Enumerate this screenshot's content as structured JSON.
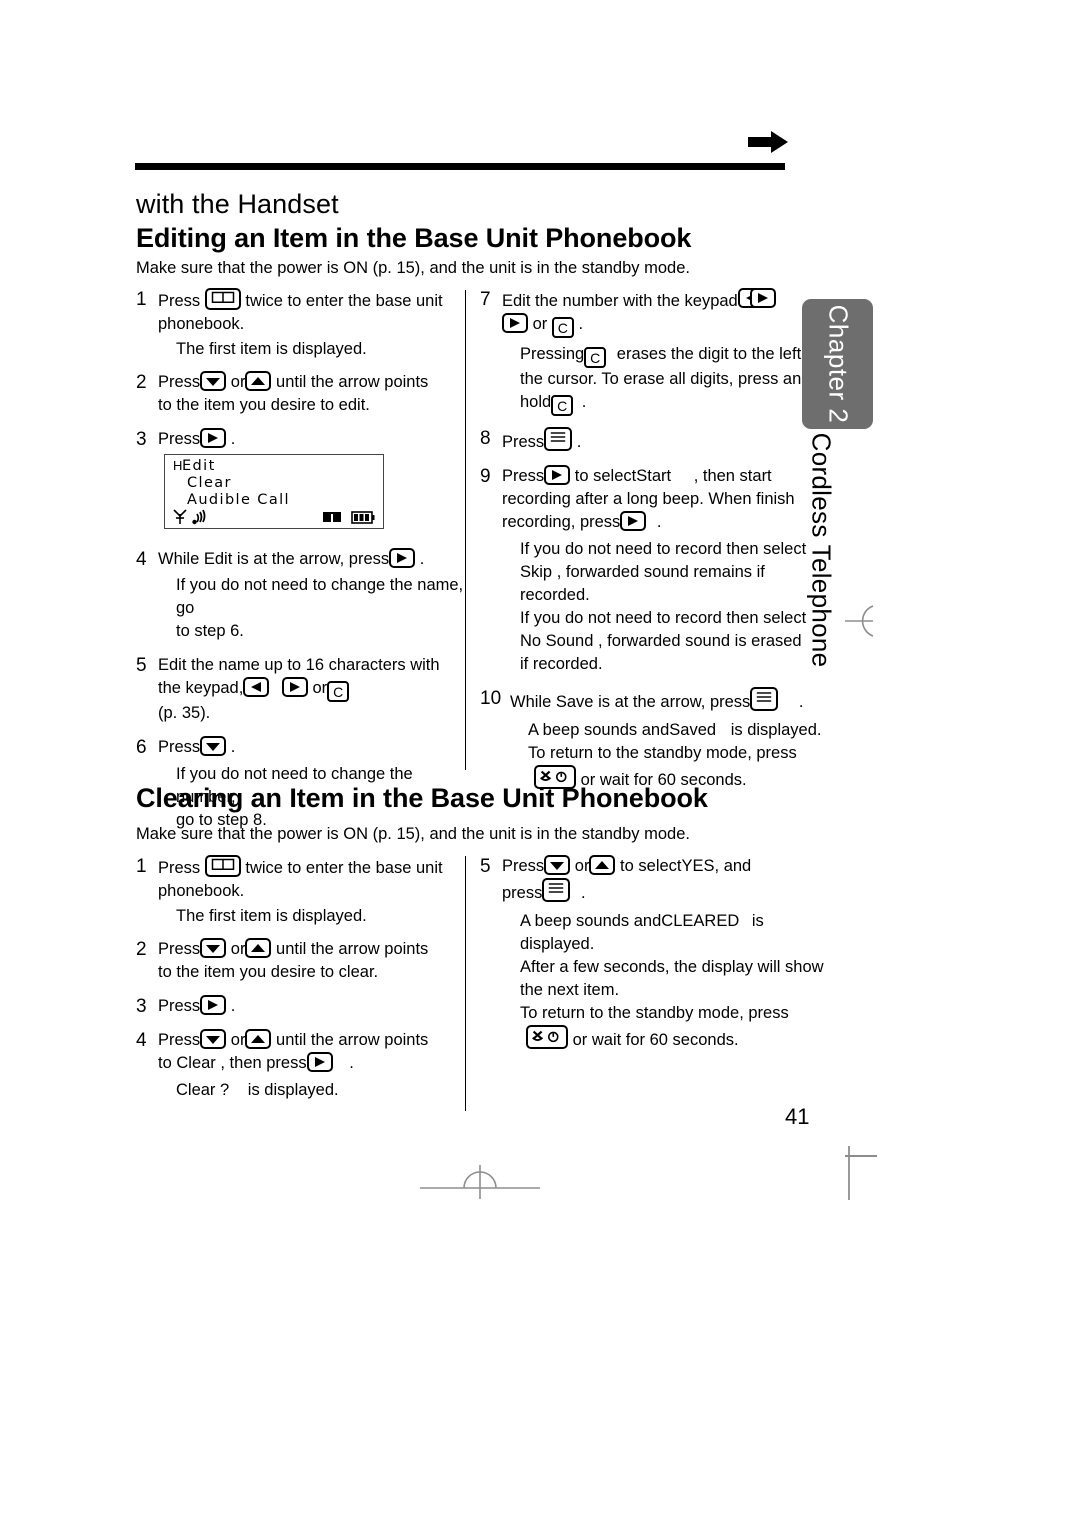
{
  "page": {
    "number": "41",
    "subheading": "with the Handset"
  },
  "chapter_tab": {
    "label": "Chapter 2",
    "name": "Cordless Telephone",
    "bg_color": "#6e6e6e",
    "text_color": "#ffffff"
  },
  "section_edit": {
    "title": "Editing an Item in the Base Unit Phonebook",
    "lead": "Make sure that the power is ON (p. 15), and the unit is in the standby mode.",
    "steps_left": [
      {
        "num": "1",
        "parts": [
          "Press ",
          "[book-key]",
          " twice to enter the base unit phonebook."
        ],
        "note": "The first item is displayed."
      },
      {
        "num": "2",
        "parts": [
          "Press ",
          "[down-key]",
          " or ",
          "[up-key]",
          " until the arrow points to the item you desire to edit."
        ]
      },
      {
        "num": "3",
        "parts": [
          "Press ",
          "[right-key]",
          " ."
        ]
      },
      {
        "num": "4",
        "parts": [
          "While ",
          "Edit",
          " is at the arrow, press ",
          "[right-key]",
          " ."
        ],
        "note": "If you do not need to change the name, go to step 6."
      },
      {
        "num": "5",
        "parts": [
          "Edit the name up to 16 characters with the keypad, ",
          "[left-key]",
          " , ",
          "[right-key]",
          " or ",
          "[C-key]",
          " (p. 35)."
        ]
      },
      {
        "num": "6",
        "parts": [
          "Press ",
          "[down-key]",
          " ."
        ],
        "note": "If you do not need to change the number, go to step 8."
      }
    ],
    "steps_right": [
      {
        "num": "7",
        "parts": [
          "Edit the number with the keypad, ",
          "[keypad-pair]",
          " , ",
          "[right-key]",
          " or ",
          "[C-key]",
          " ."
        ],
        "note": "Pressing [C-key] erases the digit to the left of the cursor. To erase all digits, press and hold [C-key] ."
      },
      {
        "num": "8",
        "parts": [
          "Press ",
          "[menu-key]",
          " ."
        ]
      },
      {
        "num": "9",
        "parts": [
          "Press ",
          "[right-key]",
          " to select ",
          "Start",
          " , then start recording after a long beep. When finish recording, press ",
          "[right-key]",
          " ."
        ],
        "notes": [
          "If you do not need to record then select Skip , forwarded sound remains if recorded.",
          "If you do not need to record then select No Sound , forwarded sound is erased if recorded."
        ]
      },
      {
        "num": "10",
        "parts": [
          "While ",
          "Save",
          " is at the arrow, press ",
          "[menu-key]",
          " ."
        ],
        "notes": [
          "A beep sounds and Saved is displayed.",
          "To return to the standby mode, press [off-key] or wait for 60 seconds."
        ]
      }
    ]
  },
  "section_clear": {
    "title": "Clearing an Item in the Base Unit Phonebook",
    "lead": "Make sure that the power is ON (p. 15), and the unit is in the standby mode.",
    "steps_left": [
      {
        "num": "1",
        "parts": [
          "Press ",
          "[book-key]",
          " twice to enter the base unit phonebook."
        ],
        "note": "The first item is displayed."
      },
      {
        "num": "2",
        "parts": [
          "Press ",
          "[down-key]",
          " or ",
          "[up-key]",
          " until the arrow points to the item you desire to clear."
        ]
      },
      {
        "num": "3",
        "parts": [
          "Press ",
          "[right-key]",
          " ."
        ]
      },
      {
        "num": "4",
        "parts": [
          "Press ",
          "[down-key]",
          " or ",
          "[up-key]",
          " until the arrow points to ",
          "Clear",
          " , then press ",
          "[right-key]",
          " ."
        ],
        "note": "Clear ? is displayed."
      }
    ],
    "steps_right": [
      {
        "num": "5",
        "parts": [
          "Press ",
          "[down-key]",
          " or ",
          "[up-key]",
          " to select ",
          "YES",
          " , and press ",
          "[menu-key]",
          " ."
        ],
        "notes": [
          "A beep sounds and CLEARED is displayed.",
          "After a few seconds, the display will show the next item.",
          "To return to the standby mode, press [off-key] or wait for 60 seconds."
        ]
      }
    ]
  },
  "lcd": {
    "cursor": "H",
    "line1": "Edit",
    "line2": "Clear",
    "line3": "Audible Call",
    "status_left": [
      "antenna-icon",
      "signal-icon"
    ],
    "status_right": [
      "book-icon",
      "battery-icon"
    ]
  },
  "text": {
    "press": "Press",
    "or": "or",
    "twice_to_enter": "twice to enter the base unit",
    "phonebook": "phonebook.",
    "first_item": "The first item is displayed.",
    "until_arrow_points": "until the arrow points",
    "to_item_edit": "to the item you desire to edit.",
    "to_item_clear": "to the item you desire to clear.",
    "period": ".",
    "comma": ",",
    "while": "While",
    "edit": "Edit",
    "is_at_arrow_press": "is at the arrow, press",
    "no_change_name": "If you do not need to change the name, go",
    "to_step_6": "to step 6.",
    "edit_name_16": "Edit the name up to 16 characters with",
    "the_keypad": "the keypad,",
    "p35": "(p. 35).",
    "no_change_number": "If you do not need to change the number,",
    "go_to_step_8": "go to step 8.",
    "edit_number_keypad": "Edit the number with the keypad",
    "pressing": "Pressing",
    "erases_digit": "erases the digit to the left of",
    "cursor_erase_all": "the cursor. To erase all digits, press and",
    "hold": "hold",
    "to_select": "to select",
    "start": "Start",
    "then_start": ", then start",
    "recording_after_beep": "recording after a long beep. When finish",
    "recording_press": "recording, press",
    "no_record_select": "If you do not need to record then select",
    "skip": "Skip",
    "forwarded_remains": ", forwarded sound remains if",
    "recorded": "recorded.",
    "no_record_select2": "If you do not need to record then select",
    "no_sound": "No Sound",
    "forwarded_erased": ", forwarded sound is erased",
    "if_recorded": "if recorded.",
    "save": "Save",
    "beep_and": "A beep sounds and",
    "saved": "Saved",
    "is_displayed": "is displayed.",
    "to_return": "To return to the standby mode, press",
    "or_wait_60": "or wait for 60 seconds.",
    "to_clear_word": "Clear",
    "then_press": ", then press",
    "clear_q": "Clear ?",
    "yes": "YES",
    "and": ", and",
    "press_lower": "press",
    "cleared": "CLEARED",
    "is_disp_short": "is",
    "displayed": "displayed.",
    "after_few_seconds": "After a few seconds, the display will show",
    "the_next_item": "the next item."
  }
}
